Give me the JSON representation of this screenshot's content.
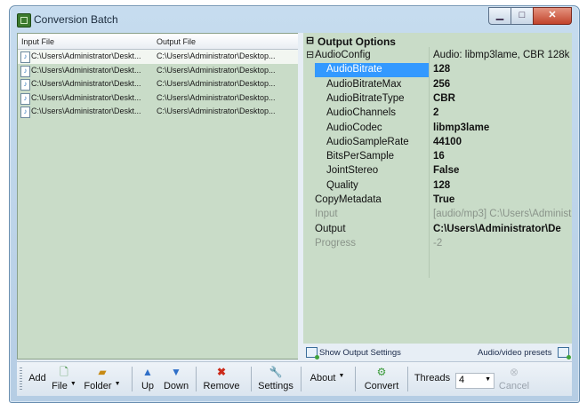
{
  "window": {
    "title": "Conversion Batch"
  },
  "file_list": {
    "columns": [
      "Input File",
      "Output File"
    ],
    "rows": [
      {
        "input": "C:\\Users\\Administrator\\Deskt...",
        "output": "C:\\Users\\Administrator\\Desktop..."
      },
      {
        "input": "C:\\Users\\Administrator\\Deskt...",
        "output": "C:\\Users\\Administrator\\Desktop..."
      },
      {
        "input": "C:\\Users\\Administrator\\Deskt...",
        "output": "C:\\Users\\Administrator\\Desktop..."
      },
      {
        "input": "C:\\Users\\Administrator\\Deskt...",
        "output": "C:\\Users\\Administrator\\Desktop..."
      },
      {
        "input": "C:\\Users\\Administrator\\Deskt...",
        "output": "C:\\Users\\Administrator\\Desktop..."
      }
    ]
  },
  "properties": {
    "category": "Output Options",
    "items": [
      {
        "name": "AudioConfig",
        "value": "Audio: libmp3lame, CBR 128k",
        "kind": "group"
      },
      {
        "name": "AudioBitrate",
        "value": "128",
        "kind": "child",
        "selected": true
      },
      {
        "name": "AudioBitrateMax",
        "value": "256",
        "kind": "child"
      },
      {
        "name": "AudioBitrateType",
        "value": "CBR",
        "kind": "child"
      },
      {
        "name": "AudioChannels",
        "value": "2",
        "kind": "child"
      },
      {
        "name": "AudioCodec",
        "value": "libmp3lame",
        "kind": "child"
      },
      {
        "name": "AudioSampleRate",
        "value": "44100",
        "kind": "child"
      },
      {
        "name": "BitsPerSample",
        "value": "16",
        "kind": "child"
      },
      {
        "name": "JointStereo",
        "value": "False",
        "kind": "child"
      },
      {
        "name": "Quality",
        "value": "128",
        "kind": "child"
      },
      {
        "name": "CopyMetadata",
        "value": "True",
        "kind": "top"
      },
      {
        "name": "Input",
        "value": "[audio/mp3] C:\\Users\\Administ",
        "kind": "top",
        "disabled": true
      },
      {
        "name": "Output",
        "value": "C:\\Users\\Administrator\\De",
        "kind": "top"
      },
      {
        "name": "Progress",
        "value": "-2",
        "kind": "top",
        "disabled": true
      }
    ]
  },
  "footer": {
    "show_output_settings": "Show Output Settings",
    "presets": "Audio/video presets"
  },
  "toolbar": {
    "add": "Add",
    "file": "File",
    "folder": "Folder",
    "up": "Up",
    "down": "Down",
    "remove": "Remove",
    "settings": "Settings",
    "about": "About",
    "convert": "Convert",
    "threads_label": "Threads",
    "threads_value": "4",
    "cancel": "Cancel"
  },
  "colors": {
    "pane_bg": "#c9dcc8",
    "selection": "#3399ff",
    "remove_icon": "#cc2a1a",
    "arrow_icon": "#2f6fc8"
  }
}
